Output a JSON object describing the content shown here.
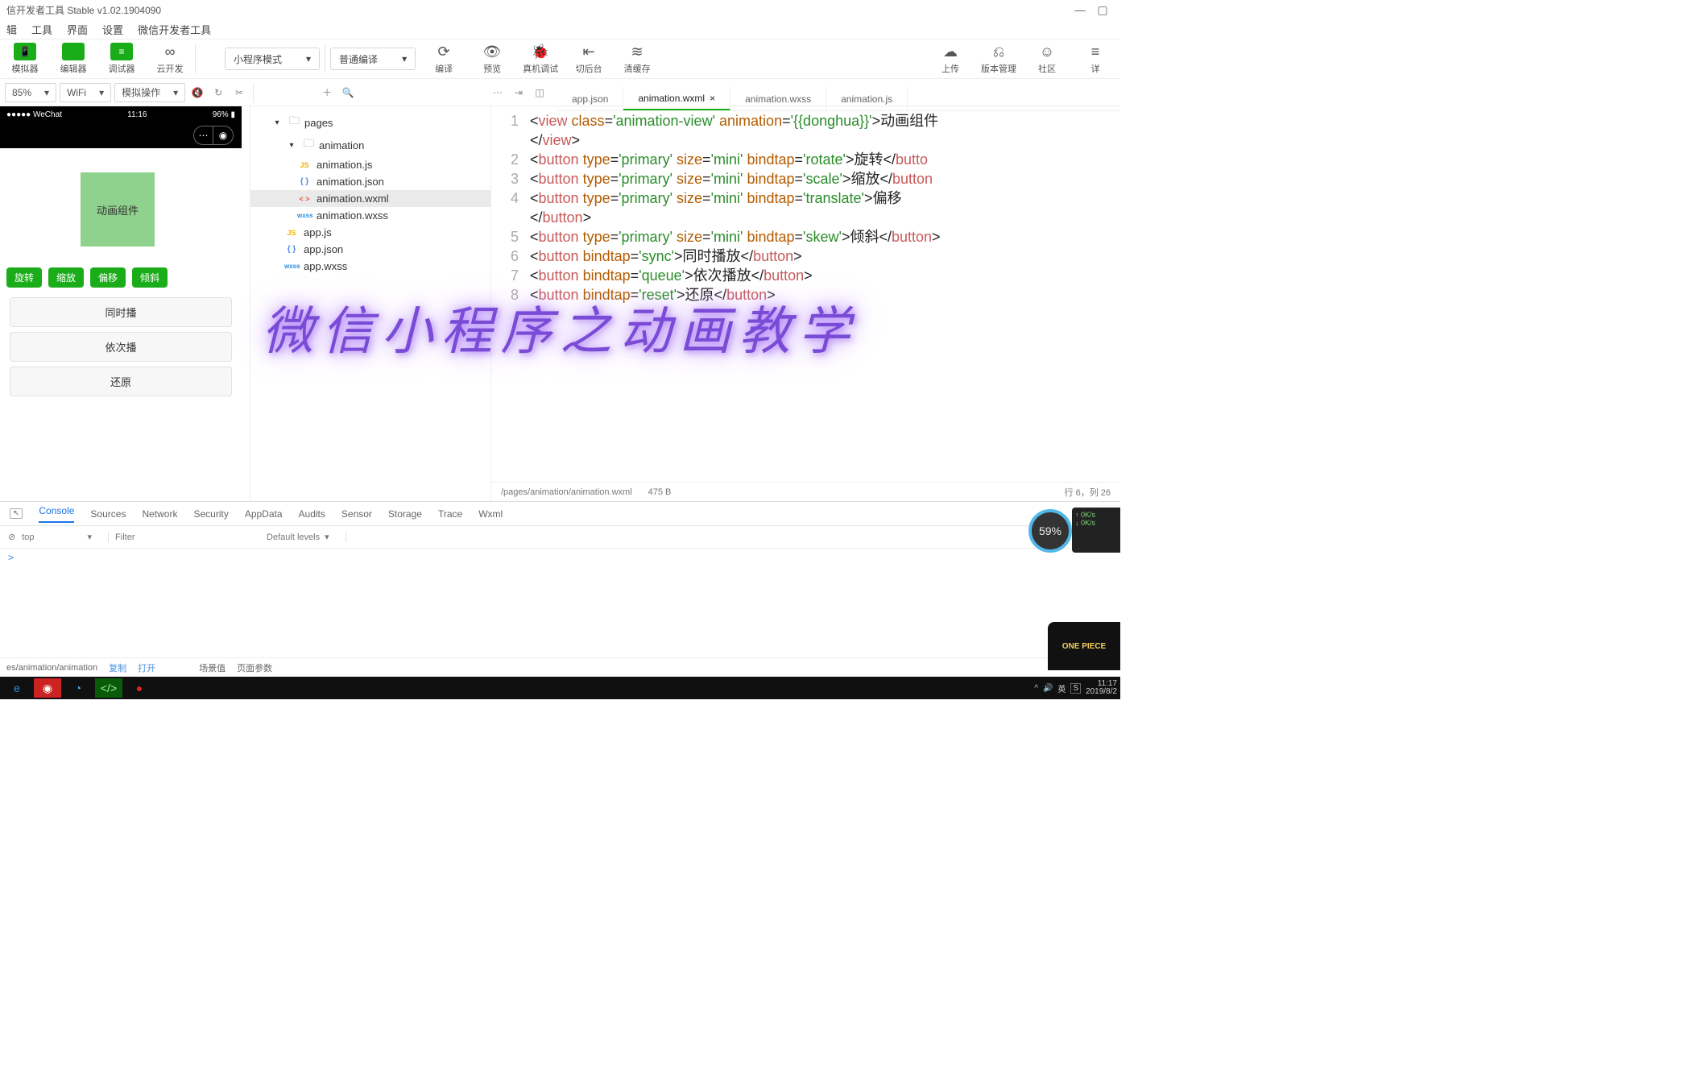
{
  "window": {
    "title": "信开发者工具 Stable v1.02.1904090"
  },
  "menu": {
    "items": [
      "辑",
      "工具",
      "界面",
      "设置",
      "微信开发者工具"
    ]
  },
  "toolbar": {
    "left": [
      {
        "label": "模拟器",
        "icon": "📱"
      },
      {
        "label": "编辑器",
        "icon": "</>"
      },
      {
        "label": "调试器",
        "icon": "≡"
      },
      {
        "label": "云开发",
        "icon": "∞"
      }
    ],
    "mode": "小程序模式",
    "compile": "普通编译",
    "center": [
      {
        "label": "编译",
        "icon": "⟳"
      },
      {
        "label": "预览",
        "icon": "👁"
      },
      {
        "label": "真机调试",
        "icon": "🐞"
      },
      {
        "label": "切后台",
        "icon": "⇤"
      },
      {
        "label": "清缓存",
        "icon": "≋"
      }
    ],
    "right": [
      {
        "label": "上传",
        "icon": "☁"
      },
      {
        "label": "版本管理",
        "icon": "⎌"
      },
      {
        "label": "社区",
        "icon": "☺"
      },
      {
        "label": "详",
        "icon": "≡"
      }
    ]
  },
  "subbar": {
    "zoom": "85%",
    "network": "WiFi",
    "mock": "模拟操作"
  },
  "simulator": {
    "carrier": "●●●●● WeChat",
    "time": "11:16",
    "battery": "96% ▮",
    "animLabel": "动画组件",
    "miniButtons": [
      "旋转",
      "缩放",
      "偏移",
      "倾斜"
    ],
    "fullButtons": [
      "同时播",
      "依次播",
      "还原"
    ]
  },
  "tree": {
    "root": "pages",
    "folder": "animation",
    "files": [
      {
        "name": "animation.js",
        "cls": "ic-js",
        "txt": "JS"
      },
      {
        "name": "animation.json",
        "cls": "ic-json",
        "txt": "{ }"
      },
      {
        "name": "animation.wxml",
        "cls": "ic-wxml",
        "txt": "< >",
        "sel": true
      },
      {
        "name": "animation.wxss",
        "cls": "ic-wxss",
        "txt": "wxss"
      }
    ],
    "rootFiles": [
      {
        "name": "app.js",
        "cls": "ic-js",
        "txt": "JS"
      },
      {
        "name": "app.json",
        "cls": "ic-json",
        "txt": "{ }"
      },
      {
        "name": "app.wxss",
        "cls": "ic-wxss",
        "txt": "wxss"
      }
    ]
  },
  "editorTabs": [
    "app.json",
    "animation.wxml",
    "animation.wxss",
    "animation.js"
  ],
  "editorActive": 1,
  "code": {
    "lines": [
      {
        "n": "1",
        "html": "<span class='t-txt'>&lt;</span><span class='t-tag'>view</span> <span class='t-attr'>class</span>=<span class='t-str'>'animation-view'</span> <span class='t-attr'>animation</span>=<span class='t-str'>'{{donghua}}'</span><span class='t-txt'>&gt;动画组件</span>"
      },
      {
        "n": "",
        "html": "<span class='t-txt'>&lt;/</span><span class='t-tag'>view</span><span class='t-txt'>&gt;</span>"
      },
      {
        "n": "2",
        "html": "<span class='t-txt'>&lt;</span><span class='t-tag'>button</span> <span class='t-attr'>type</span>=<span class='t-str'>'primary'</span> <span class='t-attr'>size</span>=<span class='t-str'>'mini'</span> <span class='t-attr'>bindtap</span>=<span class='t-str'>'rotate'</span><span class='t-txt'>&gt;旋转&lt;/</span><span class='t-tag'>butto</span>"
      },
      {
        "n": "3",
        "html": "<span class='t-txt'>&lt;</span><span class='t-tag'>button</span> <span class='t-attr'>type</span>=<span class='t-str'>'primary'</span> <span class='t-attr'>size</span>=<span class='t-str'>'mini'</span> <span class='t-attr'>bindtap</span>=<span class='t-str'>'scale'</span><span class='t-txt'>&gt;缩放&lt;/</span><span class='t-tag'>button</span>"
      },
      {
        "n": "4",
        "html": "<span class='t-txt'>&lt;</span><span class='t-tag'>button</span> <span class='t-attr'>type</span>=<span class='t-str'>'primary'</span> <span class='t-attr'>size</span>=<span class='t-str'>'mini'</span> <span class='t-attr'>bindtap</span>=<span class='t-str'>'translate'</span><span class='t-txt'>&gt;偏移</span>"
      },
      {
        "n": "",
        "html": "<span class='t-txt'>&lt;/</span><span class='t-tag'>button</span><span class='t-txt'>&gt;</span>"
      },
      {
        "n": "5",
        "html": "<span class='t-txt'>&lt;</span><span class='t-tag'>button</span> <span class='t-attr'>type</span>=<span class='t-str'>'primary'</span> <span class='t-attr'>size</span>=<span class='t-str'>'mini'</span> <span class='t-attr'>bindtap</span>=<span class='t-str'>'skew'</span><span class='t-txt'>&gt;倾斜&lt;/</span><span class='t-tag'>button</span><span class='t-txt'>&gt;</span>"
      },
      {
        "n": "6",
        "html": "<span class='t-txt'>&lt;</span><span class='t-tag'>button</span> <span class='t-attr'>bindtap</span>=<span class='t-str'>'sync'</span><span class='t-txt'>&gt;同时播放&lt;/</span><span class='t-tag'>button</span><span class='t-txt'>&gt;</span>"
      },
      {
        "n": "7",
        "html": "<span class='t-txt'>&lt;</span><span class='t-tag'>button</span> <span class='t-attr'>bindtap</span>=<span class='t-str'>'queue'</span><span class='t-txt'>&gt;依次播放&lt;/</span><span class='t-tag'>button</span><span class='t-txt'>&gt;</span>"
      },
      {
        "n": "8",
        "html": "<span class='t-txt'>&lt;</span><span class='t-tag'>button</span> <span class='t-attr'>bindtap</span>=<span class='t-str'>'reset'</span><span class='t-txt'>&gt;还原&lt;/</span><span class='t-tag'>button</span><span class='t-txt'>&gt;</span>"
      }
    ]
  },
  "editorStatus": {
    "path": "/pages/animation/animation.wxml",
    "size": "475 B",
    "pos": "行 6，列 26"
  },
  "devtools": {
    "tabs": [
      "Console",
      "Sources",
      "Network",
      "Security",
      "AppData",
      "Audits",
      "Sensor",
      "Storage",
      "Trace",
      "Wxml"
    ],
    "active": 0,
    "context": "top",
    "filterPlaceholder": "Filter",
    "levels": "Default levels",
    "prompt": ">"
  },
  "footer": {
    "path": "es/animation/animation",
    "copy": "复制",
    "open": "打开",
    "scene": "场景值",
    "pageParams": "页面参数"
  },
  "taskbar": {
    "time": "11:17",
    "date": "2019/8/2"
  },
  "perf": {
    "pct": "59%",
    "up": "0K/s",
    "down": "0K/s"
  },
  "overlay": "微信小程序之动画教学"
}
